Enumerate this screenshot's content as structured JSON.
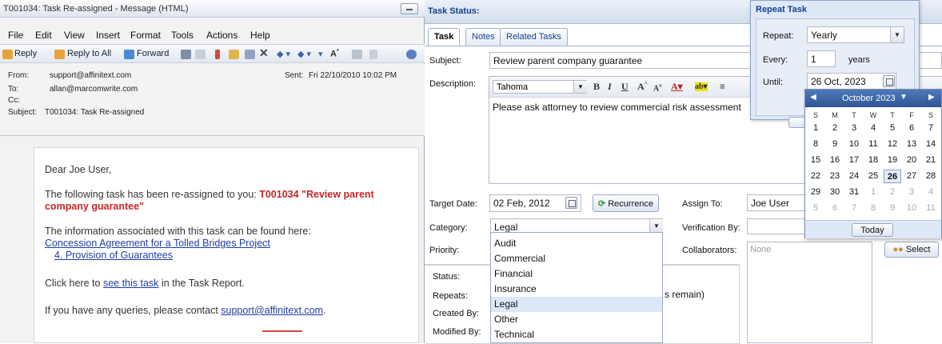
{
  "email": {
    "title": "T001034: Task Re-assigned - Message (HTML)",
    "menu": [
      "File",
      "Edit",
      "View",
      "Insert",
      "Format",
      "Tools",
      "Actions",
      "Help"
    ],
    "toolbar": {
      "reply": "Reply",
      "reply_all": "Reply to All",
      "forward": "Forward"
    },
    "headers": {
      "from_label": "From:",
      "from": "support@affinitext.com",
      "sent_label": "Sent:",
      "sent": "Fri 22/10/2010 10:02 PM",
      "to_label": "To:",
      "to": "allan@marcomwrite.com",
      "cc_label": "Cc:",
      "subject_label": "Subject:",
      "subject": "T001034: Task Re-assigned"
    },
    "body": {
      "greeting": "Dear Joe User,",
      "line1": "The following task has been re-assigned to you: ",
      "task_ref_1": "T001034 \"Review parent",
      "task_ref_2": "company guarantee\"",
      "info": "The information associated with this task can be found here:",
      "link1": "Concession Agreement for a Tolled Bridges Project",
      "link2": "4. Provision of Guarantees",
      "click_pre": "Click here to ",
      "click_link": "see this task",
      "click_post": " in the Task Report.",
      "query_pre": "If you have any queries, please contact ",
      "query_link": "support@affinitext.com",
      "query_post": "."
    }
  },
  "task": {
    "header": "Task Status:",
    "tabs": [
      "Task",
      "Notes",
      "Related Tasks"
    ],
    "subject_label": "Subject:",
    "subject": "Review parent company guarantee",
    "description_label": "Description:",
    "font": "Tahoma",
    "description": "Please ask attorney to review commercial risk assessment",
    "target_date_label": "Target Date:",
    "target_date": "02 Feb, 2012",
    "recurrence": "Recurrence",
    "assign_to_label": "Assign To:",
    "assign_to": "Joe User",
    "category_label": "Category:",
    "category": "Legal",
    "verification_label": "Verification By:",
    "priority_label": "Priority:",
    "collaborators_label": "Collaborators:",
    "collaborators": "None",
    "select": "Select",
    "category_options": [
      "Audit",
      "Commercial",
      "Financial",
      "Insurance",
      "Legal",
      "Other",
      "Technical"
    ],
    "status_label": "Status:",
    "repeats_label": "Repeats:",
    "repeats_tail": "s remain)",
    "created_label": "Created By:",
    "modified_label": "Modified By:"
  },
  "repeat": {
    "title": "Repeat Task",
    "repeat_label": "Repeat:",
    "repeat_value": "Yearly",
    "every_label": "Every:",
    "every_value": "1",
    "every_unit": "years",
    "until_label": "Until:",
    "until_value": "26 Oct, 2023"
  },
  "calendar": {
    "month": "October 2023",
    "dow": [
      "S",
      "M",
      "T",
      "W",
      "T",
      "F",
      "S"
    ],
    "rows": [
      [
        "1",
        "2",
        "3",
        "4",
        "5",
        "6",
        "7"
      ],
      [
        "8",
        "9",
        "10",
        "11",
        "12",
        "13",
        "14"
      ],
      [
        "15",
        "16",
        "17",
        "18",
        "19",
        "20",
        "21"
      ],
      [
        "22",
        "23",
        "24",
        "25",
        "26",
        "27",
        "28"
      ],
      [
        "29",
        "30",
        "31",
        "1",
        "2",
        "3",
        "4"
      ],
      [
        "5",
        "6",
        "7",
        "8",
        "9",
        "10",
        "11"
      ]
    ],
    "selected": "26",
    "today": "Today"
  }
}
